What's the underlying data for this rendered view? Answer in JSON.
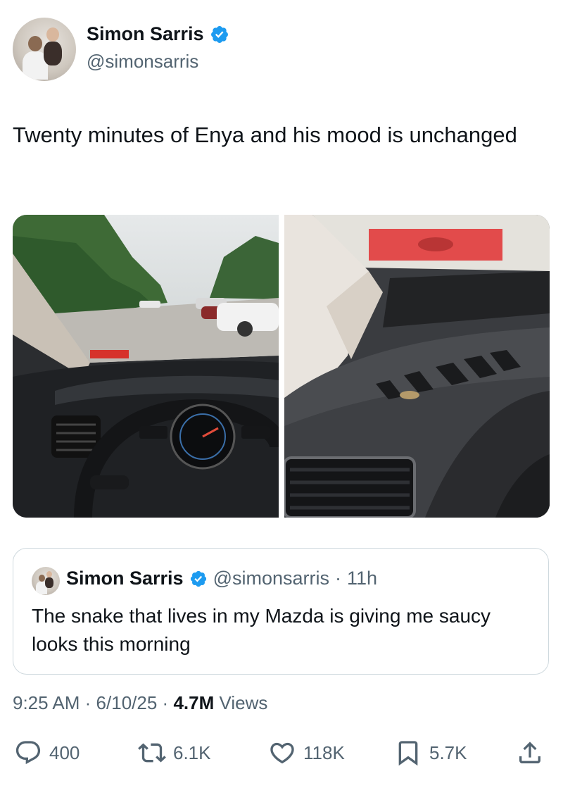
{
  "author": {
    "name": "Simon Sarris",
    "handle": "@simonsarris"
  },
  "tweet": {
    "text": "Twenty minutes of Enya and his mood is unchanged"
  },
  "media": [
    {
      "alt_icon": "car-interior-windshield-photo"
    },
    {
      "alt_icon": "car-dashboard-vent-photo"
    }
  ],
  "quote": {
    "name": "Simon Sarris",
    "handle": "@simonsarris",
    "separator": "·",
    "time": "11h",
    "text": "The snake that lives in my Mazda is giving me saucy looks this morning"
  },
  "meta": {
    "time": "9:25 AM",
    "separator": "·",
    "date": "6/10/25",
    "views_count": "4.7M",
    "views_label": "Views"
  },
  "actions": {
    "replies": "400",
    "reposts": "6.1K",
    "likes": "118K",
    "bookmarks": "5.7K"
  },
  "colors": {
    "verified": "#1d9bf0",
    "text_primary": "#0f1419",
    "text_secondary": "#536471",
    "border": "#cfd9de"
  }
}
